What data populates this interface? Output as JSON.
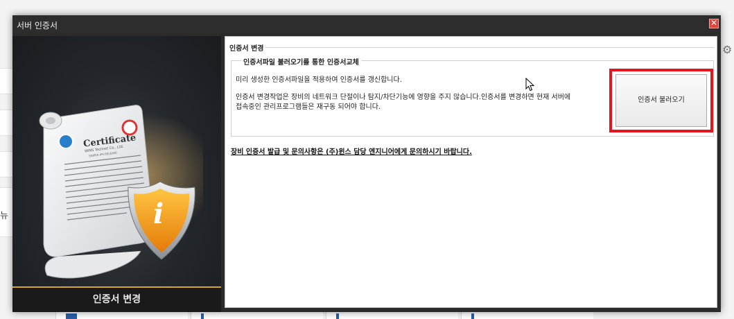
{
  "background": {
    "side_text": "뉴"
  },
  "dialog": {
    "title": "서버 인증서",
    "close_label": "✕",
    "left_caption": "인증서 변경",
    "certificate_title": "Certificate",
    "certificate_subtitle": "WINS Technet Co., Ltd.",
    "certificate_small": "SNIPER IPS RELEASE",
    "shield_symbol": "i",
    "section_label": "인증서 변경",
    "group_label": "인증서파일 불러오기를 통한 인증서교체",
    "description_1": "미리 생성한 인증서파일을 적용하여 인증서를 갱신합니다.",
    "description_2_line1": "인증서 변경작업은 장비의 네트워크 단절이나 탐지/차단기능에 영향을 주지 않습니다.인증서를 변경하면 현재 서버에",
    "description_2_line2": "접속중인 관리프로그램들은 재구동 되어야 합니다.",
    "load_button": "인증서 불러오기",
    "notice": "장비 인증서 발급 및 문의사항은 (주)윈스 담당 엔지니어에게  문의하시기 바랍니다."
  },
  "colors": {
    "highlight": "#e3151d",
    "close": "#e0453a",
    "caption_accent": "#d4a43a",
    "shield": "#f39c12"
  },
  "icons": {
    "close": "close-icon",
    "gear": "gear-icon",
    "cursor": "mouse-pointer-icon",
    "certificate": "certificate-scroll-icon",
    "shield": "info-shield-icon"
  }
}
